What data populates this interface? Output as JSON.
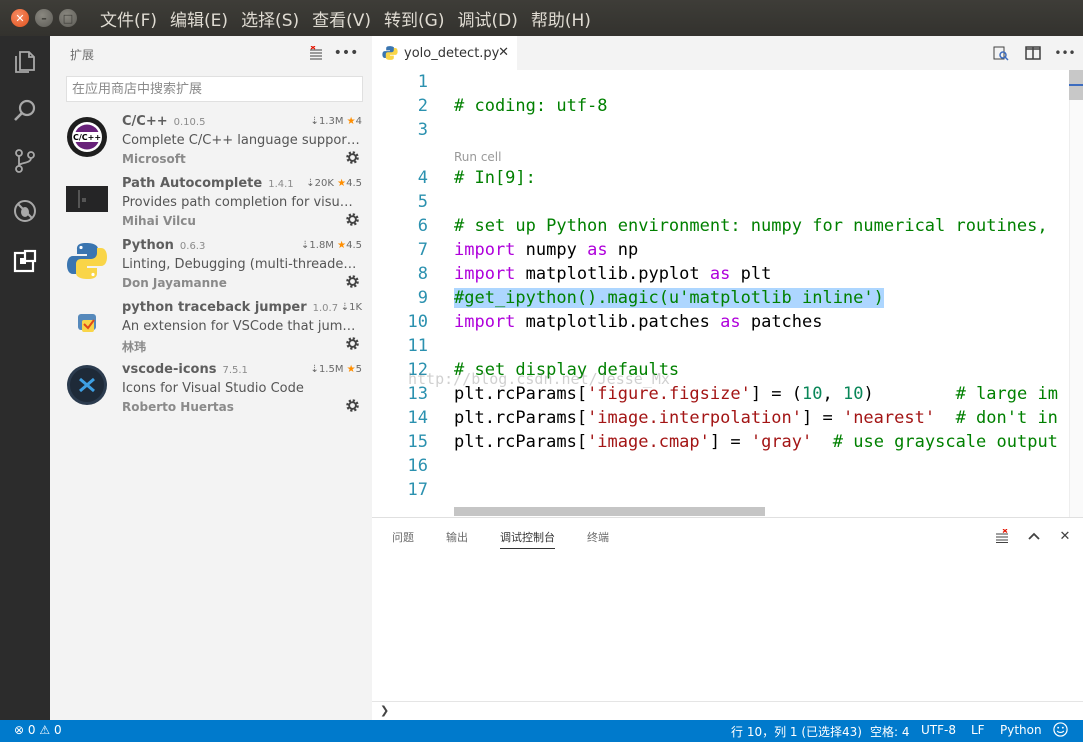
{
  "window": {
    "menu": [
      "文件(F)",
      "编辑(E)",
      "选择(S)",
      "查看(V)",
      "转到(G)",
      "调试(D)",
      "帮助(H)"
    ]
  },
  "activitybar": {
    "icons": [
      "files-icon",
      "search-icon",
      "source-control-icon",
      "debug-icon",
      "extensions-icon"
    ]
  },
  "sidebar": {
    "title": "扩展",
    "search_placeholder": "在应用商店中搜索扩展",
    "extensions": [
      {
        "name": "C/C++",
        "version": "0.10.5",
        "downloads": "1.3M",
        "rating": "4",
        "description": "Complete C/C++ language support, inc...",
        "publisher": "Microsoft"
      },
      {
        "name": "Path Autocomplete",
        "version": "1.4.1",
        "downloads": "20K",
        "rating": "4.5",
        "description": "Provides path completion for visual stu...",
        "publisher": "Mihai Vilcu"
      },
      {
        "name": "Python",
        "version": "0.6.3",
        "downloads": "1.8M",
        "rating": "4.5",
        "description": "Linting, Debugging (multi-threaded, re...",
        "publisher": "Don Jayamanne"
      },
      {
        "name": "python traceback jumper",
        "version": "1.0.7",
        "downloads": "1K",
        "description": "An extension for VSCode that jumps to...",
        "publisher": "林玮"
      },
      {
        "name": "vscode-icons",
        "version": "7.5.1",
        "downloads": "1.5M",
        "rating": "5",
        "description": "Icons for Visual Studio Code",
        "publisher": "Roberto Huertas"
      }
    ],
    "cpp_logo_text": "C/C++"
  },
  "editor": {
    "tab_label": "yolo_detect.py",
    "codelens": "Run cell",
    "watermark": "http://blog.csdn.net/Jesse_Mx",
    "line_numbers": [
      "1",
      "2",
      "3",
      "4",
      "5",
      "6",
      "7",
      "8",
      "9",
      "10",
      "11",
      "12",
      "13",
      "14",
      "15",
      "16",
      "17"
    ],
    "code": {
      "l2": "# coding: utf-8",
      "l4": "# In[9]:",
      "l6": "# set up Python environment: numpy for numerical routines,",
      "l7_kw": "import",
      "l7_mod": " numpy ",
      "l7_as": "as",
      "l7_alias": " np",
      "l8_kw": "import",
      "l8_mod": " matplotlib.pyplot ",
      "l8_as": "as",
      "l8_alias": " plt",
      "l9": "#get_ipython().magic(u'matplotlib inline')",
      "l10_kw": "import",
      "l10_mod": " matplotlib.patches ",
      "l10_as": "as",
      "l10_alias": " patches",
      "l12": "# set display defaults",
      "l13_a": "plt.rcParams[",
      "l13_s": "'figure.figsize'",
      "l13_b": "] = (",
      "l13_n1": "10",
      "l13_c": ", ",
      "l13_n2": "10",
      "l13_d": ")        ",
      "l13_com": "# large im",
      "l14_a": "plt.rcParams[",
      "l14_s": "'image.interpolation'",
      "l14_b": "] = ",
      "l14_s2": "'nearest'",
      "l14_c": "  ",
      "l14_com": "# don't in",
      "l15_a": "plt.rcParams[",
      "l15_s": "'image.cmap'",
      "l15_b": "] = ",
      "l15_s2": "'gray'",
      "l15_c": "  ",
      "l15_com": "# use grayscale output"
    }
  },
  "panel": {
    "tabs": [
      "问题",
      "输出",
      "调试控制台",
      "终端"
    ],
    "active_tab": "调试控制台",
    "prompt": "❯"
  },
  "statusbar": {
    "errors": "0",
    "warnings": "0",
    "position": "行 10，列 1 (已选择43)",
    "indent": "空格: 4",
    "encoding": "UTF-8",
    "eol": "LF",
    "language": "Python"
  },
  "colors": {
    "activitybar": "#2c2c2c",
    "sidebar": "#f3f3f3",
    "statusbar": "#007acc",
    "comment": "#008000",
    "keyword": "#af00db",
    "string": "#a31515",
    "number": "#098658",
    "line_number": "#2b91af",
    "selection": "#add6ff"
  }
}
